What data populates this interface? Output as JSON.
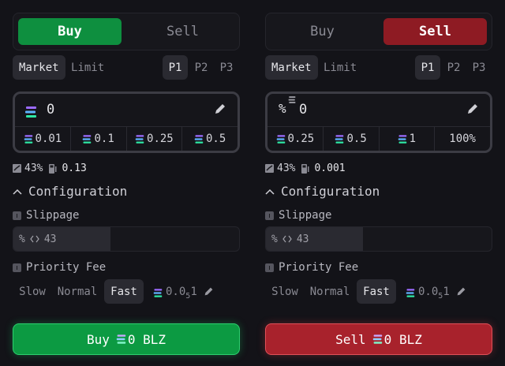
{
  "buy_panel": {
    "side_buttons": [
      "Buy",
      "Sell"
    ],
    "order_tabs": [
      "Market",
      "Limit"
    ],
    "presets": [
      "P1",
      "P2",
      "P3"
    ],
    "amount_prefix": "",
    "amount": "0",
    "quick_amounts": [
      "0.01",
      "0.1",
      "0.25",
      "0.5"
    ],
    "stat_percent": "43%",
    "stat_value": "0.13",
    "config_label": "Configuration",
    "slippage_label": "Slippage",
    "slippage_prefix": "%",
    "slippage_value": "43",
    "slippage_fill": 0.43,
    "priority_label": "Priority Fee",
    "speeds": [
      "Slow",
      "Normal",
      "Fast"
    ],
    "fee_base": "0.0",
    "fee_sub": "5",
    "fee_tail": "1",
    "action_verb": "Buy",
    "action_amount": "0 BLZ"
  },
  "sell_panel": {
    "side_buttons": [
      "Buy",
      "Sell"
    ],
    "order_tabs": [
      "Market",
      "Limit"
    ],
    "presets": [
      "P1",
      "P2",
      "P3"
    ],
    "amount_prefix": "%",
    "amount": "0",
    "quick_amounts": [
      "0.25",
      "0.5",
      "1",
      "100%"
    ],
    "stat_percent": "43%",
    "stat_value": "0.001",
    "config_label": "Configuration",
    "slippage_label": "Slippage",
    "slippage_prefix": "%",
    "slippage_value": "43",
    "slippage_fill": 0.43,
    "priority_label": "Priority Fee",
    "speeds": [
      "Slow",
      "Normal",
      "Fast"
    ],
    "fee_base": "0.0",
    "fee_sub": "5",
    "fee_tail": "1",
    "action_verb": "Sell",
    "action_amount": "0 BLZ"
  },
  "colors": {
    "buy_accent": "#0e8f3f",
    "sell_accent": "#8e1b23",
    "background": "#131318"
  }
}
